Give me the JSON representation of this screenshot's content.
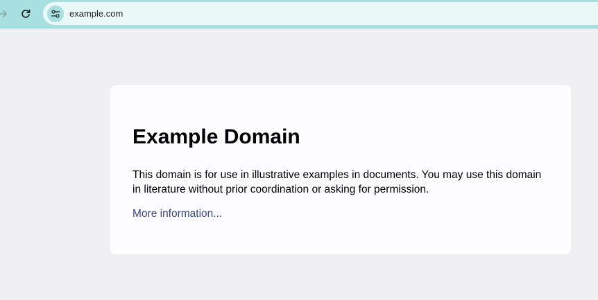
{
  "browser": {
    "url": "example.com",
    "icons": {
      "forward": "arrow-right-icon",
      "reload": "reload-icon",
      "site_info": "tune-icon"
    },
    "colors": {
      "toolbar": "#a8dfe0",
      "omnibox": "#eaf8f7"
    }
  },
  "page": {
    "heading": "Example Domain",
    "body_text": "This domain is for use in illustrative examples in documents. You may use this domain in literature without prior coordination or asking for permission.",
    "link_text": "More information...",
    "colors": {
      "background": "#f0f0f2",
      "card": "#fdfdff",
      "link": "#38488f"
    }
  }
}
